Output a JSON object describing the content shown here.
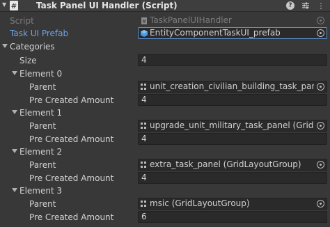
{
  "header": {
    "title": "Task Panel UI Handler (Script)",
    "icons": [
      "help-icon",
      "settings-sliders-icon",
      "more-icon"
    ]
  },
  "props": {
    "script": {
      "label": "Script",
      "value": "TaskPanelUIHandler"
    },
    "prefab": {
      "label": "Task UI Prefab",
      "value": "EntityComponentTaskUI_prefab"
    },
    "categories": {
      "label": "Categories"
    },
    "size": {
      "label": "Size",
      "value": "4"
    }
  },
  "elements": [
    {
      "label": "Element 0",
      "parent_label": "Parent",
      "parent_value": "unit_creation_civilian_building_task_panel (GridLayoutGroup)",
      "amount_label": "Pre Created Amount",
      "amount_value": "4"
    },
    {
      "label": "Element 1",
      "parent_label": "Parent",
      "parent_value": "upgrade_unit_military_task_panel (GridLayoutGroup)",
      "amount_label": "Pre Created Amount",
      "amount_value": "4"
    },
    {
      "label": "Element 2",
      "parent_label": "Parent",
      "parent_value": "extra_task_panel (GridLayoutGroup)",
      "amount_label": "Pre Created Amount",
      "amount_value": "4"
    },
    {
      "label": "Element 3",
      "parent_label": "Parent",
      "parent_value": "msic (GridLayoutGroup)",
      "amount_label": "Pre Created Amount",
      "amount_value": "6"
    }
  ],
  "colors": {
    "background": "#383838",
    "field": "#2a2a2a",
    "link_label": "#6ea3e6",
    "highlight": "#5a8ecf"
  }
}
